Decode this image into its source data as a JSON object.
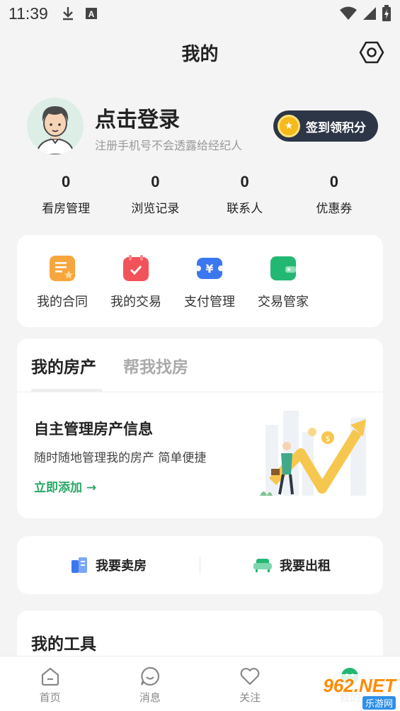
{
  "status": {
    "time": "11:39"
  },
  "header": {
    "title": "我的"
  },
  "profile": {
    "login_text": "点击登录",
    "subtitle": "注册手机号不会透露给经纪人",
    "signin_label": "签到领积分"
  },
  "stats": [
    {
      "value": "0",
      "label": "看房管理"
    },
    {
      "value": "0",
      "label": "浏览记录"
    },
    {
      "value": "0",
      "label": "联系人"
    },
    {
      "value": "0",
      "label": "优惠券"
    }
  ],
  "services": [
    {
      "label": "我的合同",
      "icon": "contract-icon",
      "color": "#f7a63d"
    },
    {
      "label": "我的交易",
      "icon": "trade-icon",
      "color": "#f2535b"
    },
    {
      "label": "支付管理",
      "icon": "payment-icon",
      "color": "#3b78f0"
    },
    {
      "label": "交易管家",
      "icon": "wallet-icon",
      "color": "#22b873"
    }
  ],
  "property": {
    "tabs": [
      "我的房产",
      "帮我找房"
    ],
    "title": "自主管理房产信息",
    "subtitle": "随时随地管理我的房产 简单便捷",
    "link": "立即添加 →"
  },
  "actions": {
    "sell": "我要卖房",
    "rent": "我要出租"
  },
  "tools": {
    "title": "我的工具"
  },
  "nav": [
    {
      "label": "首页",
      "icon": "home-icon"
    },
    {
      "label": "消息",
      "icon": "message-icon"
    },
    {
      "label": "关注",
      "icon": "heart-icon"
    },
    {
      "label": "我的",
      "icon": "profile-icon"
    }
  ],
  "watermark": {
    "brand": "962.NET",
    "sub": "乐游网"
  },
  "colors": {
    "accent": "#27a866",
    "dark_button": "#2c3646",
    "background": "#f4f4f4"
  }
}
